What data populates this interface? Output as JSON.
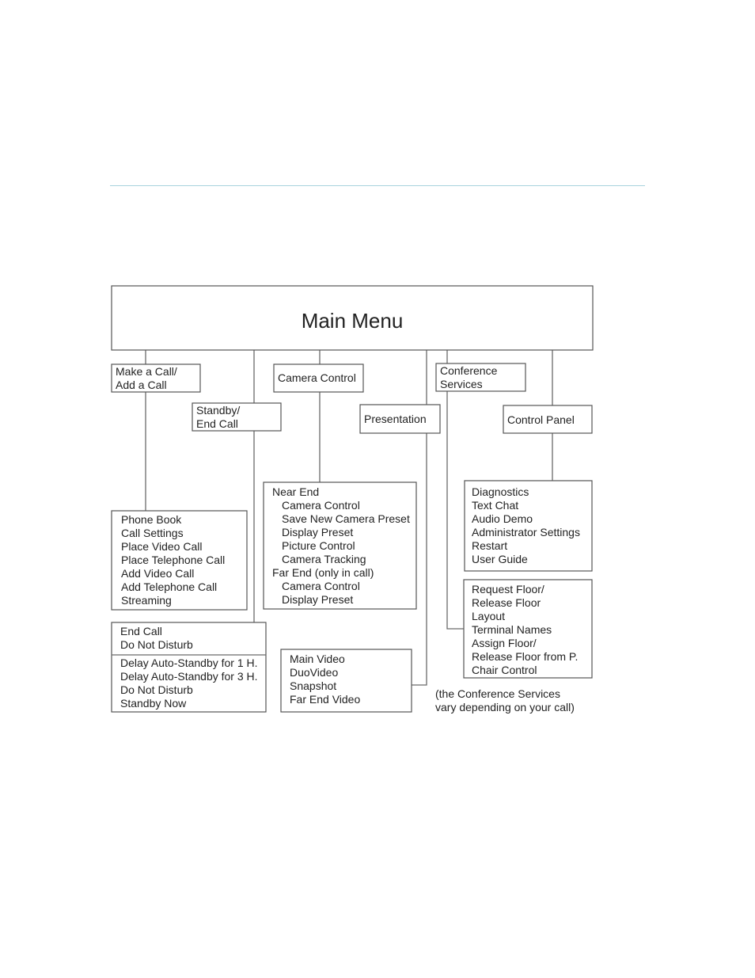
{
  "diagram": {
    "title": "Main Menu",
    "categories": {
      "make_call": [
        "Make a Call/",
        "Add a Call"
      ],
      "standby": [
        "Standby/",
        "End Call"
      ],
      "camera": [
        "Camera Control"
      ],
      "presentation": [
        "Presentation"
      ],
      "conference": [
        "Conference",
        "Services"
      ],
      "control_panel": [
        "Control Panel"
      ]
    },
    "submenus": {
      "make_call": [
        "Phone Book",
        "Call Settings",
        "Place Video Call",
        "Place Telephone Call",
        "Add Video Call",
        "Add Telephone Call",
        "Streaming"
      ],
      "camera": [
        {
          "text": "Near End",
          "indent": 0
        },
        {
          "text": "Camera Control",
          "indent": 1
        },
        {
          "text": "Save New Camera Preset",
          "indent": 1
        },
        {
          "text": "Display Preset",
          "indent": 1
        },
        {
          "text": "Picture Control",
          "indent": 1
        },
        {
          "text": "Camera Tracking",
          "indent": 1
        },
        {
          "text": "Far End (only in call)",
          "indent": 0
        },
        {
          "text": "Camera Control",
          "indent": 1
        },
        {
          "text": "Display Preset",
          "indent": 1
        }
      ],
      "control_panel": [
        "Diagnostics",
        "Text Chat",
        "Audio Demo",
        "Administrator Settings",
        "Restart",
        "User Guide"
      ],
      "conference": [
        "Request Floor/",
        "Release Floor",
        "Layout",
        "Terminal Names",
        "Assign Floor/",
        "Release Floor from P.",
        "Chair Control"
      ],
      "standby_in_call": [
        "End Call",
        "Do Not Disturb"
      ],
      "standby_idle": [
        "Delay Auto-Standby for 1 H.",
        "Delay Auto-Standby for 3 H.",
        "Do Not Disturb",
        "Standby Now"
      ],
      "presentation": [
        "Main Video",
        "DuoVideo",
        "Snapshot",
        "Far End Video"
      ]
    },
    "note": [
      "(the Conference Services",
      "vary depending on your call)"
    ],
    "colors": {
      "rule": "#a9d3de",
      "stroke": "#555555",
      "text": "#222222"
    }
  }
}
